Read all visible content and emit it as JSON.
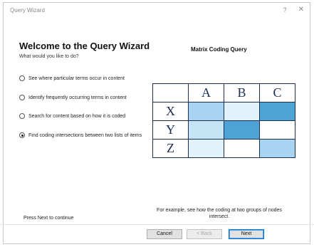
{
  "window": {
    "title": "Query Wizard",
    "help_glyph": "?",
    "close_glyph": "✕"
  },
  "wizard": {
    "heading": "Welcome to the Query Wizard",
    "subheading": "What would you like to do?",
    "options": [
      {
        "label": "See where particular terms occur in content",
        "selected": false
      },
      {
        "label": "Identify frequently occurring terms in content",
        "selected": false
      },
      {
        "label": "Search for content based on how it is coded",
        "selected": false
      },
      {
        "label": "Find coding intersections between two lists of items",
        "selected": true
      }
    ]
  },
  "diagram": {
    "title": "Matrix Coding Query",
    "columns": [
      "A",
      "B",
      "C"
    ],
    "rows": [
      {
        "label": "X",
        "cell_colors": [
          "#a7d4f0",
          "#e2f2fb",
          "#4da3d6"
        ]
      },
      {
        "label": "Y",
        "cell_colors": [
          "#c5e4f6",
          "#4da3d6",
          "#ffffff"
        ]
      },
      {
        "label": "Z",
        "cell_colors": [
          "#e2f2fb",
          "#ffffff",
          "#a7d4f0"
        ]
      }
    ],
    "caption": "For example, see how the coding at two groups of nodes intersect."
  },
  "footer": {
    "hint": "Press Next to continue",
    "cancel_label": "Cancel",
    "back_label": "< Back",
    "next_label": "Next"
  },
  "colors": {
    "grid_border": "#1d2e52",
    "default_button_border": "#0078d7"
  }
}
